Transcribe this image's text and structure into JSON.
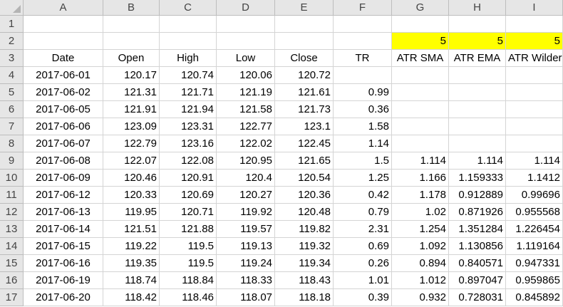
{
  "columns": [
    "A",
    "B",
    "C",
    "D",
    "E",
    "F",
    "G",
    "H",
    "I"
  ],
  "row_numbers": [
    "1",
    "2",
    "3",
    "4",
    "5",
    "6",
    "7",
    "8",
    "9",
    "10",
    "11",
    "12",
    "13",
    "14",
    "15",
    "16",
    "17"
  ],
  "period_row": [
    "",
    "",
    "",
    "",
    "",
    "",
    "5",
    "5",
    "5"
  ],
  "headers": [
    "Date",
    "Open",
    "High",
    "Low",
    "Close",
    "TR",
    "ATR SMA",
    "ATR EMA",
    "ATR Wilder"
  ],
  "rows": [
    [
      "2017-06-01",
      "120.17",
      "120.74",
      "120.06",
      "120.72",
      "",
      "",
      "",
      ""
    ],
    [
      "2017-06-02",
      "121.31",
      "121.71",
      "121.19",
      "121.61",
      "0.99",
      "",
      "",
      ""
    ],
    [
      "2017-06-05",
      "121.91",
      "121.94",
      "121.58",
      "121.73",
      "0.36",
      "",
      "",
      ""
    ],
    [
      "2017-06-06",
      "123.09",
      "123.31",
      "122.77",
      "123.1",
      "1.58",
      "",
      "",
      ""
    ],
    [
      "2017-06-07",
      "122.79",
      "123.16",
      "122.02",
      "122.45",
      "1.14",
      "",
      "",
      ""
    ],
    [
      "2017-06-08",
      "122.07",
      "122.08",
      "120.95",
      "121.65",
      "1.5",
      "1.114",
      "1.114",
      "1.114"
    ],
    [
      "2017-06-09",
      "120.46",
      "120.91",
      "120.4",
      "120.54",
      "1.25",
      "1.166",
      "1.159333",
      "1.1412"
    ],
    [
      "2017-06-12",
      "120.33",
      "120.69",
      "120.27",
      "120.36",
      "0.42",
      "1.178",
      "0.912889",
      "0.99696"
    ],
    [
      "2017-06-13",
      "119.95",
      "120.71",
      "119.92",
      "120.48",
      "0.79",
      "1.02",
      "0.871926",
      "0.955568"
    ],
    [
      "2017-06-14",
      "121.51",
      "121.88",
      "119.57",
      "119.82",
      "2.31",
      "1.254",
      "1.351284",
      "1.226454"
    ],
    [
      "2017-06-15",
      "119.22",
      "119.5",
      "119.13",
      "119.32",
      "0.69",
      "1.092",
      "1.130856",
      "1.119164"
    ],
    [
      "2017-06-16",
      "119.35",
      "119.5",
      "119.24",
      "119.34",
      "0.26",
      "0.894",
      "0.840571",
      "0.947331"
    ],
    [
      "2017-06-19",
      "118.74",
      "118.84",
      "118.33",
      "118.43",
      "1.01",
      "1.012",
      "0.897047",
      "0.959865"
    ],
    [
      "2017-06-20",
      "118.42",
      "118.46",
      "118.07",
      "118.18",
      "0.39",
      "0.932",
      "0.728031",
      "0.845892"
    ]
  ],
  "colors": {
    "highlight": "#ffff00",
    "header_bg": "#e6e6e6",
    "gridline": "#d4d4d4"
  }
}
